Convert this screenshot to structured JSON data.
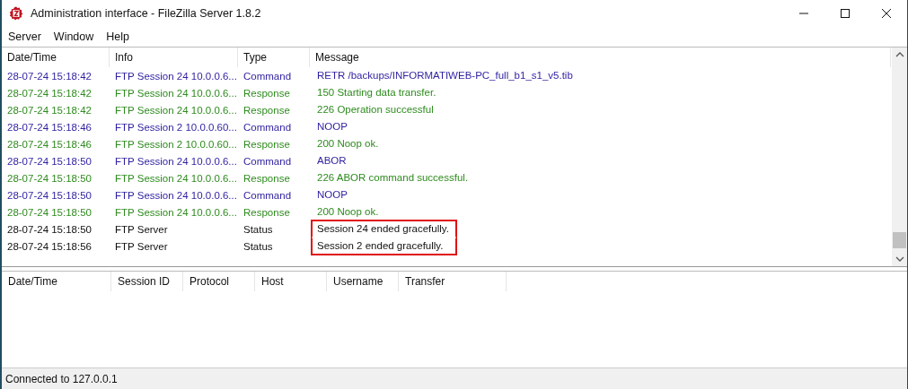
{
  "window": {
    "title": "Administration interface - FileZilla Server 1.8.2"
  },
  "menu": [
    "Server",
    "Window",
    "Help"
  ],
  "log": {
    "columns": [
      "Date/Time",
      "Info",
      "Type",
      "Message"
    ],
    "rows": [
      {
        "kind": "command",
        "time": "28-07-24 15:18:42",
        "info": "FTP Session 24 10.0.0.6...",
        "type": "Command",
        "message": "RETR /backups/INFORMATIWEB-PC_full_b1_s1_v5.tib",
        "highlighted": false
      },
      {
        "kind": "response",
        "time": "28-07-24 15:18:42",
        "info": "FTP Session 24 10.0.0.6...",
        "type": "Response",
        "message": "150 Starting data transfer.",
        "highlighted": false
      },
      {
        "kind": "response",
        "time": "28-07-24 15:18:42",
        "info": "FTP Session 24 10.0.0.6...",
        "type": "Response",
        "message": "226 Operation successful",
        "highlighted": false
      },
      {
        "kind": "command",
        "time": "28-07-24 15:18:46",
        "info": "FTP Session 2 10.0.0.60...",
        "type": "Command",
        "message": "NOOP",
        "highlighted": false
      },
      {
        "kind": "response",
        "time": "28-07-24 15:18:46",
        "info": "FTP Session 2 10.0.0.60...",
        "type": "Response",
        "message": "200 Noop ok.",
        "highlighted": false
      },
      {
        "kind": "command",
        "time": "28-07-24 15:18:50",
        "info": "FTP Session 24 10.0.0.6...",
        "type": "Command",
        "message": "ABOR",
        "highlighted": false
      },
      {
        "kind": "response",
        "time": "28-07-24 15:18:50",
        "info": "FTP Session 24 10.0.0.6...",
        "type": "Response",
        "message": "226 ABOR command successful.",
        "highlighted": false
      },
      {
        "kind": "command",
        "time": "28-07-24 15:18:50",
        "info": "FTP Session 24 10.0.0.6...",
        "type": "Command",
        "message": "NOOP",
        "highlighted": false
      },
      {
        "kind": "response",
        "time": "28-07-24 15:18:50",
        "info": "FTP Session 24 10.0.0.6...",
        "type": "Response",
        "message": "200 Noop ok.",
        "highlighted": false
      },
      {
        "kind": "status",
        "time": "28-07-24 15:18:50",
        "info": "FTP Server",
        "type": "Status",
        "message": "Session 24 ended gracefully.",
        "highlighted": true
      },
      {
        "kind": "status",
        "time": "28-07-24 15:18:56",
        "info": "FTP Server",
        "type": "Status",
        "message": "Session 2 ended gracefully.",
        "highlighted": true
      }
    ]
  },
  "sessions": {
    "columns": [
      "Date/Time",
      "Session ID",
      "Protocol",
      "Host",
      "Username",
      "Transfer"
    ]
  },
  "status_bar": "Connected to 127.0.0.1"
}
